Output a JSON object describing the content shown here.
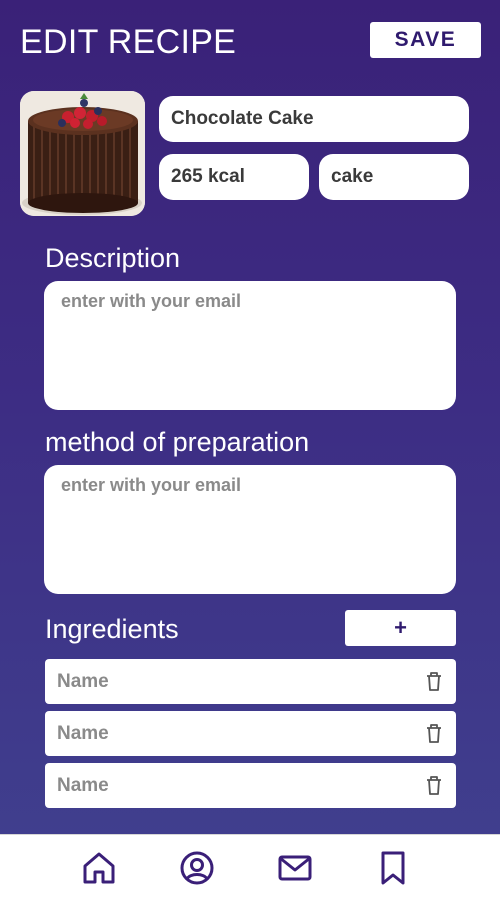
{
  "header": {
    "title": "EDIT RECIPE",
    "save_label": "SAVE"
  },
  "recipe": {
    "name": "Chocolate Cake",
    "calories": "265 kcal",
    "category": "cake"
  },
  "description": {
    "label": "Description",
    "placeholder": "enter with your email"
  },
  "method": {
    "label": "method of preparation",
    "placeholder": "enter with your email"
  },
  "ingredients": {
    "label": "Ingredients",
    "add_label": "+",
    "items": [
      {
        "placeholder": "Name"
      },
      {
        "placeholder": "Name"
      },
      {
        "placeholder": "Name"
      }
    ]
  },
  "bottom_nav": {
    "items": [
      {
        "icon": "home-icon"
      },
      {
        "icon": "profile-icon"
      },
      {
        "icon": "mail-icon"
      },
      {
        "icon": "bookmark-icon"
      }
    ]
  },
  "colors": {
    "accent": "#2f1a6e",
    "background_top": "#3a2178",
    "background_bottom": "#40418f"
  }
}
